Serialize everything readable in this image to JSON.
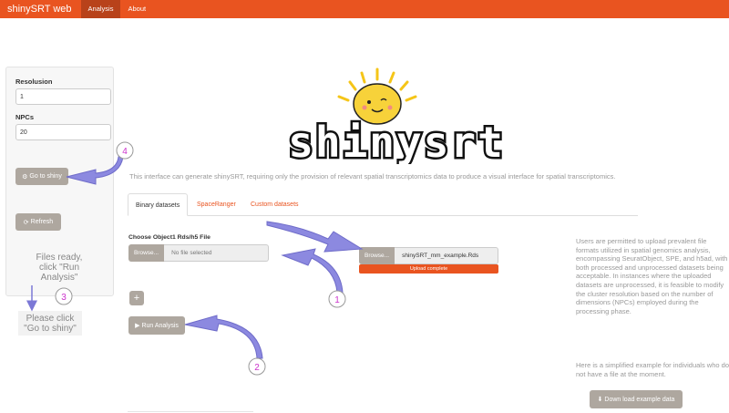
{
  "navbar": {
    "brand": "shinySRT web",
    "items": [
      {
        "label": "Analysis",
        "active": true
      },
      {
        "label": "About",
        "active": false
      }
    ]
  },
  "sidebar": {
    "resolution_label": "Resolusion",
    "resolution_value": "1",
    "npcs_label": "NPCs",
    "npcs_value": "20",
    "go_button": "Go to shiny",
    "refresh_button": "Refresh"
  },
  "annotations": {
    "files_ready": [
      "Files ready,",
      "click \"Run",
      "Analysis\""
    ],
    "please_click": [
      "Please click",
      "\"Go to shiny\""
    ],
    "markers": [
      "1",
      "2",
      "3",
      "4"
    ]
  },
  "logo_text": "shinysrt",
  "description": "This interface can generate shinySRT, requiring only the provision of relevant spatial transcriptomics data to produce a visual interface for spatial transcriptomics.",
  "tabs": [
    {
      "label": "Binary datasets",
      "active": true
    },
    {
      "label": "SpaceRanger",
      "active": false
    },
    {
      "label": "Custom datasets",
      "active": false
    }
  ],
  "upload": {
    "label": "Choose Object1 Rds/h5 File",
    "browse": "Browse...",
    "placeholder": "No file selected",
    "example_file": "shinySRT_mm_example.Rds",
    "progress_text": "Upload complete",
    "progress": 1.0
  },
  "add_button": "+",
  "run_button": "Run Analysis",
  "info": {
    "paragraph1": "Users are permitted to upload prevalent file formats utilized in spatial genomics analysis, encompassing SeuratObject, SPE, and h5ad, with both processed and unprocessed datasets being acceptable. In instances where the uploaded datasets are unprocessed, it is feasible to modify the cluster resolution based on the number of dimensions (NPCs) employed during the processing phase.",
    "paragraph2": "Here is a simplified example for individuals who do not have a file at the moment.",
    "download_button": "Down load example data"
  },
  "colors": {
    "navbar": "#e95420",
    "nav_active": "#b8421a",
    "button_grey": "#aea79f",
    "annotation_arrow": "#7b78d6",
    "marker_text": "#cc33cc",
    "sun": "#f5c518"
  }
}
